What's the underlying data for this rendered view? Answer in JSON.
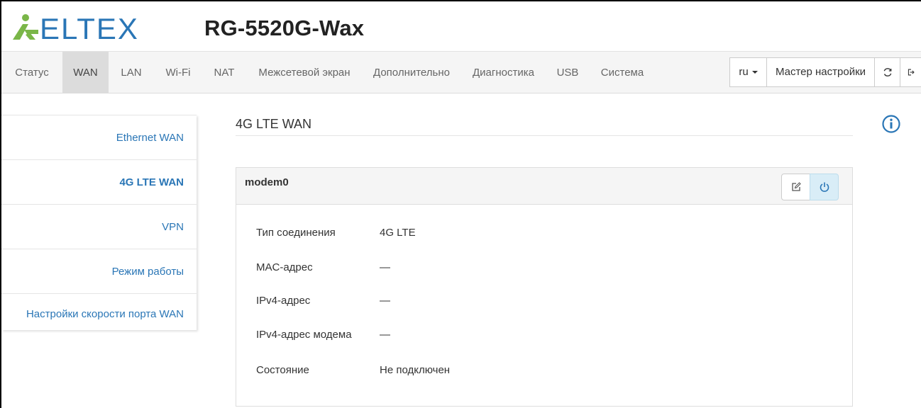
{
  "header": {
    "brand": "ELTEX",
    "model": "RG-5520G-Wax"
  },
  "nav": {
    "items": [
      "Статус",
      "WAN",
      "LAN",
      "Wi-Fi",
      "NAT",
      "Межсетевой экран",
      "Дополнительно",
      "Диагностика",
      "USB",
      "Система"
    ],
    "active": "WAN",
    "language": "ru",
    "wizard": "Мастер настройки",
    "refresh_icon": "refresh-icon",
    "logout_icon": "logout-icon"
  },
  "sidebar": {
    "items": [
      "Ethernet WAN",
      "4G LTE WAN",
      "VPN",
      "Режим работы",
      "Настройки скорости порта WAN"
    ],
    "active": "4G LTE WAN"
  },
  "main": {
    "title": "4G LTE WAN",
    "panel": {
      "title": "modem0",
      "rows": [
        {
          "label": "Тип соединения",
          "value": "4G LTE"
        },
        {
          "label": "MAC-адрес",
          "value": "—"
        },
        {
          "label": "IPv4-адрес",
          "value": "—"
        },
        {
          "label": "IPv4-адрес модема",
          "value": "—"
        },
        {
          "label": "Состояние",
          "value": "Не подключен"
        }
      ]
    }
  },
  "colors": {
    "brand": "#2a76b6",
    "logo_green": "#7ab648",
    "nav_bg": "#f5f5f5",
    "nav_active": "#dcdcdc",
    "power_btn_bg": "#d9edf7"
  }
}
